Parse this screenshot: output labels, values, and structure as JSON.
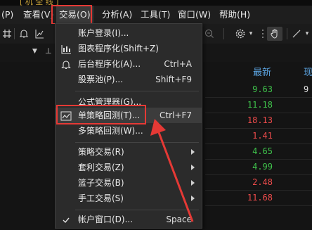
{
  "top_fragment": "  [ 机 全 线 ]",
  "menubar": {
    "items": [
      {
        "label": "(P)"
      },
      {
        "label": "查看(V)"
      },
      {
        "label": "交易(O)"
      },
      {
        "label": "分析(A)"
      },
      {
        "label": "工具(T)"
      },
      {
        "label": "窗口(W)"
      },
      {
        "label": "帮助(H)"
      }
    ]
  },
  "grid": {
    "header_latest": "最新",
    "header_current": "现",
    "values": [
      {
        "text": "9.63",
        "color": "#3fc24b"
      },
      {
        "text": "11.18",
        "color": "#3fc24b"
      },
      {
        "text": "18.13",
        "color": "#ef4b4b"
      },
      {
        "text": "1.41",
        "color": "#ef4b4b"
      },
      {
        "text": "4.65",
        "color": "#3fc24b"
      },
      {
        "text": "4.99",
        "color": "#3fc24b"
      },
      {
        "text": "2.48",
        "color": "#ef4b4b"
      },
      {
        "text": "11.68",
        "color": "#ef4b4b"
      }
    ],
    "right_fragment": "9"
  },
  "dropdown": {
    "items": [
      {
        "label": "账户登录(I)...",
        "shortcut": "",
        "icon": "",
        "submenu": false
      },
      {
        "label": "图表程序化(Shift+Z)",
        "shortcut": "",
        "icon": "chart-program-icon",
        "submenu": false
      },
      {
        "label": "后台程序化(A)...",
        "shortcut": "Ctrl+A",
        "icon": "bell-icon",
        "submenu": false
      },
      {
        "label": "股票池(P)...",
        "shortcut": "Shift+F9",
        "icon": "",
        "submenu": false
      },
      {
        "label": "公式管理器(G)...",
        "shortcut": "",
        "icon": "",
        "submenu": false
      },
      {
        "label": "单策略回测(T)...",
        "shortcut": "Ctrl+F7",
        "icon": "backtest-icon",
        "submenu": false
      },
      {
        "label": "多策略回测(W)...",
        "shortcut": "",
        "icon": "",
        "submenu": false
      },
      {
        "label": "策略交易(R)",
        "shortcut": "",
        "icon": "",
        "submenu": true
      },
      {
        "label": "套利交易(Z)",
        "shortcut": "",
        "icon": "",
        "submenu": true
      },
      {
        "label": "篮子交易(B)",
        "shortcut": "",
        "icon": "",
        "submenu": true
      },
      {
        "label": "手工交易(S)",
        "shortcut": "",
        "icon": "",
        "submenu": true
      },
      {
        "label": "帐户窗口(D)...",
        "shortcut": "Space",
        "icon": "check-icon",
        "submenu": false
      }
    ]
  },
  "colors": {
    "annotation": "#e53935",
    "accent_blue": "#5ba3e0",
    "up_red": "#ef4b4b",
    "down_green": "#3fc24b"
  }
}
